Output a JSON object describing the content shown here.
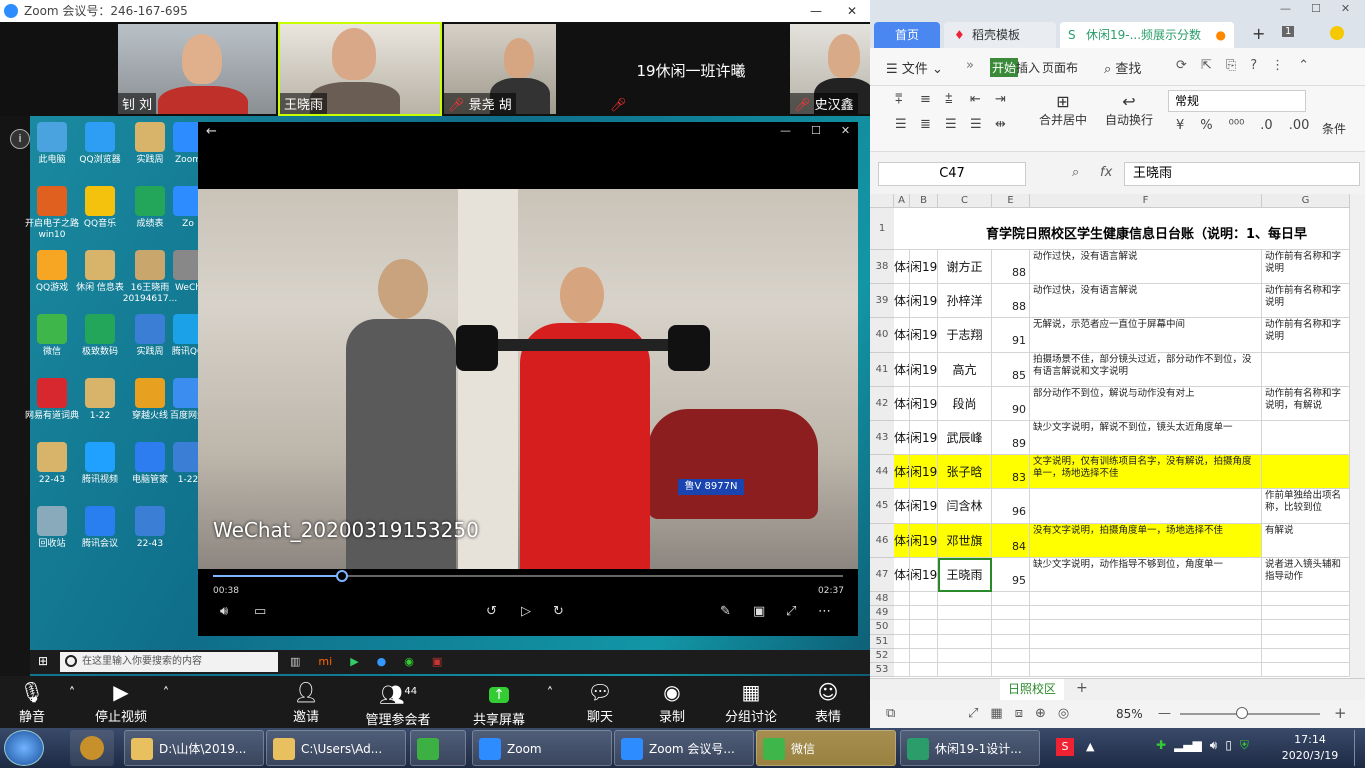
{
  "zoom": {
    "title": "Zoom 会议号：246-167-695",
    "participants": [
      {
        "name": "钊 刘",
        "muted": false
      },
      {
        "name": "王晓雨",
        "muted": false,
        "active": true
      },
      {
        "name": "景尧 胡",
        "muted": true
      },
      {
        "name": "19休闲一班许曦",
        "muted": true,
        "text_only": true
      },
      {
        "name": "史汉鑫",
        "muted": true
      }
    ],
    "toolbar": {
      "mute": "静音",
      "stop_video": "停止视频",
      "invite": "邀请",
      "manage": "管理参会者",
      "participant_count": "44",
      "share": "共享屏幕",
      "chat": "聊天",
      "record": "录制",
      "breakout": "分组讨论",
      "reaction": "表情"
    }
  },
  "desktop_icons": [
    {
      "label": "此电脑",
      "color": "#4aa3df"
    },
    {
      "label": "QQ浏览器",
      "color": "#2e9ef4"
    },
    {
      "label": "实践周",
      "color": "#d8b36a"
    },
    {
      "label": "Zoom",
      "color": "#2d8cff"
    },
    {
      "label": "开启电子之路 win10",
      "color": "#e06020"
    },
    {
      "label": "QQ音乐",
      "color": "#f4c20d"
    },
    {
      "label": "成绩表",
      "color": "#23a65a"
    },
    {
      "label": "Zo",
      "color": "#2d8cff"
    },
    {
      "label": "QQ游戏",
      "color": "#f6a623"
    },
    {
      "label": "休闲 信息表",
      "color": "#d8b36a"
    },
    {
      "label": "16王晓雨 20194617...",
      "color": "#c9a66b"
    },
    {
      "label": "WeCh",
      "color": "#888"
    },
    {
      "label": "微信",
      "color": "#3fb64a"
    },
    {
      "label": "极致数码",
      "color": "#23a65a"
    },
    {
      "label": "实践周",
      "color": "#3a7fd5"
    },
    {
      "label": "腾讯QQ",
      "color": "#1aa1e8"
    },
    {
      "label": "网易有道词典",
      "color": "#d7282f"
    },
    {
      "label": "1-22",
      "color": "#d8b36a"
    },
    {
      "label": "穿越火线",
      "color": "#e8a020"
    },
    {
      "label": "百度网盘",
      "color": "#3b8ef0"
    },
    {
      "label": "22-43",
      "color": "#d8b36a"
    },
    {
      "label": "腾讯视频",
      "color": "#20a0ff"
    },
    {
      "label": "电脑管家",
      "color": "#2d7cf0"
    },
    {
      "label": "1-22",
      "color": "#3a7fd5"
    },
    {
      "label": "回收站",
      "color": "#8ab"
    },
    {
      "label": "腾讯会议",
      "color": "#2a7ff0"
    },
    {
      "label": "22-43",
      "color": "#3a7fd5"
    }
  ],
  "player": {
    "filename": "WeChat_20200319153250",
    "current_time": "00:38",
    "duration": "02:37",
    "progress": 0.204,
    "plate": "鲁V 8977N"
  },
  "desktop_taskbar": {
    "search_placeholder": "在这里输入你要搜索的内容"
  },
  "wps": {
    "tabs": [
      "首页",
      "稻壳模板",
      "休闲19-...频展示分数"
    ],
    "tab_count": "1",
    "menu": {
      "file": "文件",
      "start": "开始",
      "insert": "插入",
      "layout": "页面布",
      "search": "查找"
    },
    "ribbon": {
      "format_value": "常规",
      "merge": "合并居中",
      "wrap": "自动换行",
      "cond": "条件"
    },
    "cell_ref": "C47",
    "fx_label": "fx",
    "formula": "王晓雨",
    "columns": [
      "A",
      "B",
      "C",
      "E",
      "F",
      "G"
    ],
    "header_row_text": "育学院日照校区学生健康信息日台账（说明：1、每日早",
    "rows": [
      {
        "r": "38",
        "a": "体社",
        "b": "闲19-",
        "c": "谢方正",
        "e": "88",
        "f": "动作过快，没有语言解说",
        "g": "动作前有名称和字说明",
        "hl": false
      },
      {
        "r": "39",
        "a": "体社",
        "b": "闲19-",
        "c": "孙梓洋",
        "e": "88",
        "f": "动作过快，没有语言解说",
        "g": "动作前有名称和字说明",
        "hl": false
      },
      {
        "r": "40",
        "a": "体社",
        "b": "闲19-",
        "c": "于志翔",
        "e": "91",
        "f": "无解说，示范者应一直位于屏幕中间",
        "g": "动作前有名称和字说明",
        "hl": false
      },
      {
        "r": "41",
        "a": "体社",
        "b": "闲19-",
        "c": "高亢",
        "e": "85",
        "f": "拍摄场景不佳，部分镜头过近，部分动作不到位，没有语言解说和文字说明",
        "g": "",
        "hl": false
      },
      {
        "r": "42",
        "a": "体社",
        "b": "闲19-",
        "c": "段尚",
        "e": "90",
        "f": "部分动作不到位，解说与动作没有对上",
        "g": "动作前有名称和字说明，有解说",
        "hl": false
      },
      {
        "r": "43",
        "a": "体社",
        "b": "闲19-",
        "c": "武辰峰",
        "e": "89",
        "f": "缺少文字说明，解说不到位，镜头太近角度单一",
        "g": "",
        "hl": false
      },
      {
        "r": "44",
        "a": "体社",
        "b": "闲19-",
        "c": "张子晗",
        "e": "83",
        "f": "文字说明，仅有训练项目名字，没有解说，拍摄角度单一，场地选择不佳",
        "g": "",
        "hl": true
      },
      {
        "r": "45",
        "a": "体社",
        "b": "闲19-",
        "c": "闫含林",
        "e": "96",
        "f": "",
        "g": "作前单独给出项名称，比较到位",
        "hl": false
      },
      {
        "r": "46",
        "a": "体社",
        "b": "闲19-",
        "c": "邓世旗",
        "e": "84",
        "f": "没有文字说明，拍摄角度单一，场地选择不佳",
        "g": "有解说",
        "hl": true
      },
      {
        "r": "47",
        "a": "体社",
        "b": "闲19-",
        "c": "王晓雨",
        "e": "95",
        "f": "缺少文字说明，动作指导不够到位，角度单一",
        "g": "说者进入镜头辅和指导动作",
        "hl": false
      }
    ],
    "empty_rows": [
      "48",
      "49",
      "50",
      "51",
      "52",
      "53"
    ],
    "sheet_tab": "日照校区",
    "zoom_level": "85%"
  },
  "taskbar": {
    "items": [
      {
        "label": "D:\\山体\\2019...",
        "color": "#e8c060"
      },
      {
        "label": "C:\\Users\\Ad...",
        "color": "#e8c060"
      },
      {
        "label": "",
        "color": "#3cb043"
      },
      {
        "label": "Zoom",
        "color": "#2d8cff"
      },
      {
        "label": "Zoom 会议号...",
        "color": "#2d8cff"
      },
      {
        "label": "微信",
        "color": "#3fb64a"
      },
      {
        "label": "休闲19-1设计...",
        "color": "#2a9d6a"
      }
    ],
    "time": "17:14",
    "date": "2020/3/19"
  }
}
